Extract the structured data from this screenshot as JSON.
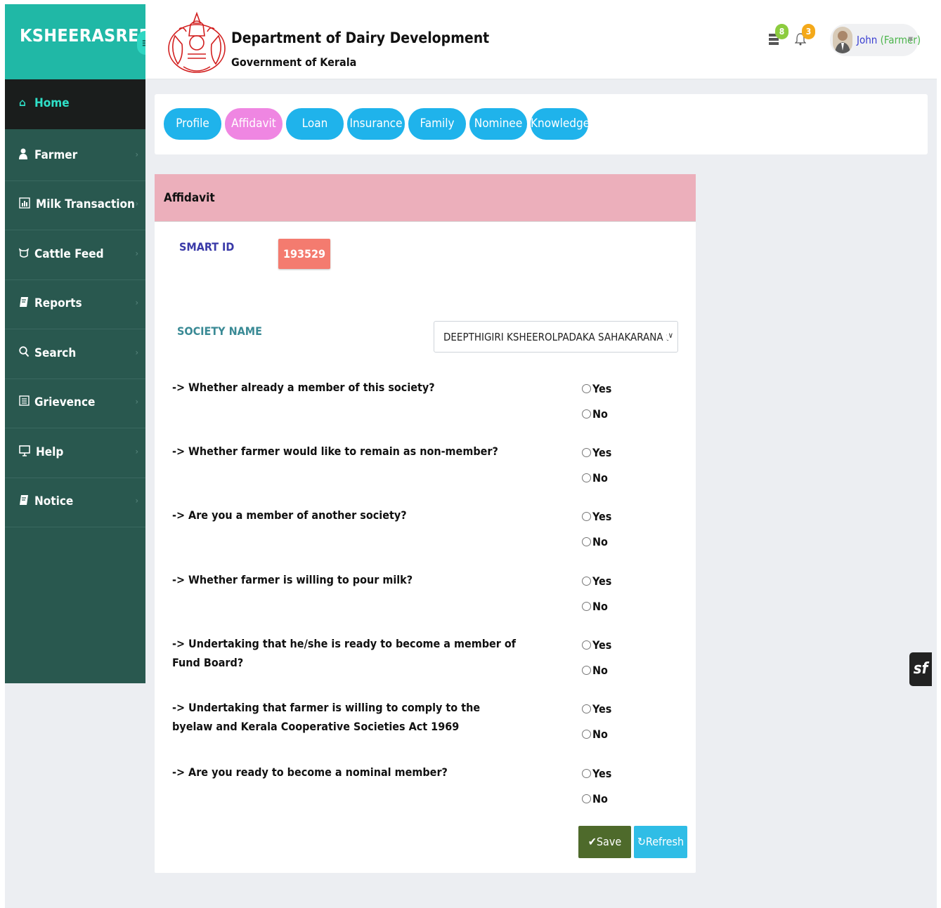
{
  "brand": {
    "title": "KSHEERASREE",
    "toggle_icon": "menu-icon"
  },
  "header": {
    "dept_title": "Department of Dairy Development",
    "dept_subtitle": "Government of Kerala",
    "messages_count": "8",
    "notifications_count": "3",
    "user_name": "John",
    "user_role": "(Farmer)"
  },
  "sidebar": {
    "items": [
      {
        "label": "Home",
        "icon": "home-icon"
      },
      {
        "label": "Farmer",
        "icon": "user-icon"
      },
      {
        "label": "Milk Transaction",
        "icon": "chart-icon"
      },
      {
        "label": "Cattle Feed",
        "icon": "cattle-icon"
      },
      {
        "label": "Reports",
        "icon": "book-icon"
      },
      {
        "label": "Search",
        "icon": "search-icon"
      },
      {
        "label": "Grievence",
        "icon": "list-icon"
      },
      {
        "label": "Help",
        "icon": "monitor-icon"
      },
      {
        "label": "Notice",
        "icon": "book-icon"
      }
    ]
  },
  "tabs": [
    {
      "label": "Profile"
    },
    {
      "label": "Affidavit"
    },
    {
      "label": "Loan"
    },
    {
      "label": "Insurance"
    },
    {
      "label": "Family"
    },
    {
      "label": "Nominee"
    },
    {
      "label": "Knowledge"
    }
  ],
  "affidavit": {
    "title": "Affidavit",
    "smart_id_label": "SMART ID",
    "smart_id_value": "193529",
    "society_label": "SOCIETY NAME",
    "society_value": "DEEPTHIGIRI KSHEEROLPADAKA SAHAKARANA SANGAM",
    "yes_label": "Yes",
    "no_label": "No",
    "questions": [
      "-> Whether already a member of this society?",
      "-> Whether farmer would like to remain as non-member?",
      "-> Are you a member of another society?",
      "-> Whether farmer is willing to pour milk?",
      "-> Undertaking that he/she is ready to become a member of Fund Board?",
      "-> Undertaking that farmer is willing to comply to the byelaw and Kerala Cooperative Societies Act 1969",
      "-> Are you ready to become a nominal member?"
    ],
    "save_label": "✔Save",
    "refresh_label": "↻Refresh"
  }
}
